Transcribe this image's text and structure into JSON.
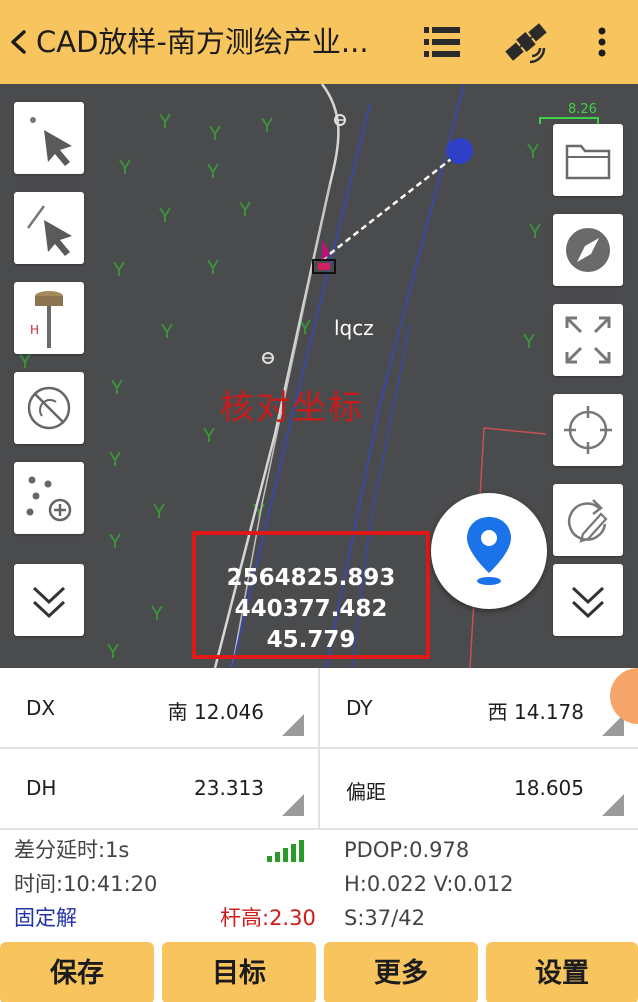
{
  "header": {
    "title": "CAD放样-南方测绘产业...",
    "back_icon": "chevron-left-icon",
    "menu_icon": "list-menu-icon",
    "satellite_icon": "satellite-icon",
    "more_icon": "more-vertical-icon"
  },
  "map": {
    "scale_text": "8.26",
    "point_label": "lqcz",
    "annotation": "核对坐标",
    "coordinates": {
      "northing": "2564825.893",
      "easting": "440377.482",
      "elevation": "45.779"
    },
    "left_tools": [
      "select-point-icon",
      "select-line-icon",
      "gps-rover-icon",
      "no-signal-icon",
      "point-add-icon",
      "expand-down-icon"
    ],
    "right_tools": [
      "folder-icon",
      "compass-icon",
      "fullscreen-icon",
      "crosshair-icon",
      "edit-rotate-icon",
      "expand-down-icon"
    ],
    "locate_icon": "location-pin-icon"
  },
  "readings": {
    "dx_label": "DX",
    "dx_value": "南 12.046",
    "dy_label": "DY",
    "dy_value": "西 14.178",
    "dh_label": "DH",
    "dh_value": "23.313",
    "offset_label": "偏距",
    "offset_value": "18.605"
  },
  "status": {
    "delay": "差分延时:1s",
    "time": "时间:10:41:20",
    "solution": "固定解",
    "pole_height": "杆高:2.30",
    "pdop": "PDOP:0.978",
    "precision": "H:0.022  V:0.012",
    "satellites": "S:37/42"
  },
  "buttons": {
    "save": "保存",
    "target": "目标",
    "more": "更多",
    "settings": "设置"
  },
  "colors": {
    "accent": "#f8c45e",
    "map_background": "#4a4b4d",
    "alert_red": "#e01818",
    "locate_blue": "#1a73e8"
  }
}
